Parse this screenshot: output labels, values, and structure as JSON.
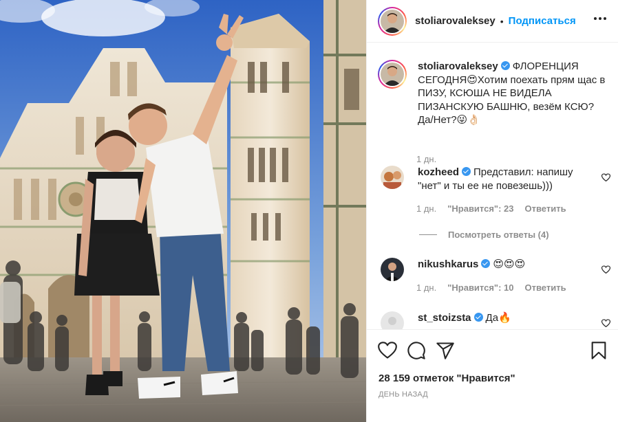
{
  "post": {
    "author": "stoliarovaleksey",
    "follow_label": "Подписаться",
    "separator": "•",
    "more_icon": "more-horizontal-icon",
    "photo_alt": "Two people posing in front of Florence Cathedral and Giotto's bell tower",
    "caption": {
      "username": "stoliarovaleksey",
      "text": "ФЛОРЕНЦИЯ СЕГОДНЯ😍Хотим поехать прям щас в ПИЗУ, КСЮША НЕ ВИДЕЛА ПИЗАНСКУЮ БАШНЮ, везём КСЮ? Да/Нет?😜👌🏻",
      "time": "1 дн."
    },
    "comments": [
      {
        "username": "kozheed",
        "verified": true,
        "text": "Представил: напишу \"нет\" и ты ее не повезешь)))",
        "time": "1 дн.",
        "likes": "\"Нравится\": 23",
        "reply": "Ответить"
      },
      {
        "username": "nikushkarus",
        "verified": true,
        "text": "😍😍😍",
        "time": "1 дн.",
        "likes": "\"Нравится\": 10",
        "reply": "Ответить"
      },
      {
        "username": "st_stoizsta",
        "verified": true,
        "text": "Да🔥"
      }
    ],
    "view_replies": "Посмотреть ответы (4)",
    "actions": {
      "like_icon": "heart-icon",
      "comment_icon": "comment-icon",
      "share_icon": "share-icon",
      "save_icon": "bookmark-icon"
    },
    "likes_count": "28 159 отметок \"Нравится\"",
    "posted_ago": "ДЕНЬ НАЗАД"
  },
  "colors": {
    "link_blue": "#0095f6",
    "verified_blue": "#3897f0",
    "text": "#262626",
    "muted": "#8e8e8e",
    "border": "#efefef"
  }
}
